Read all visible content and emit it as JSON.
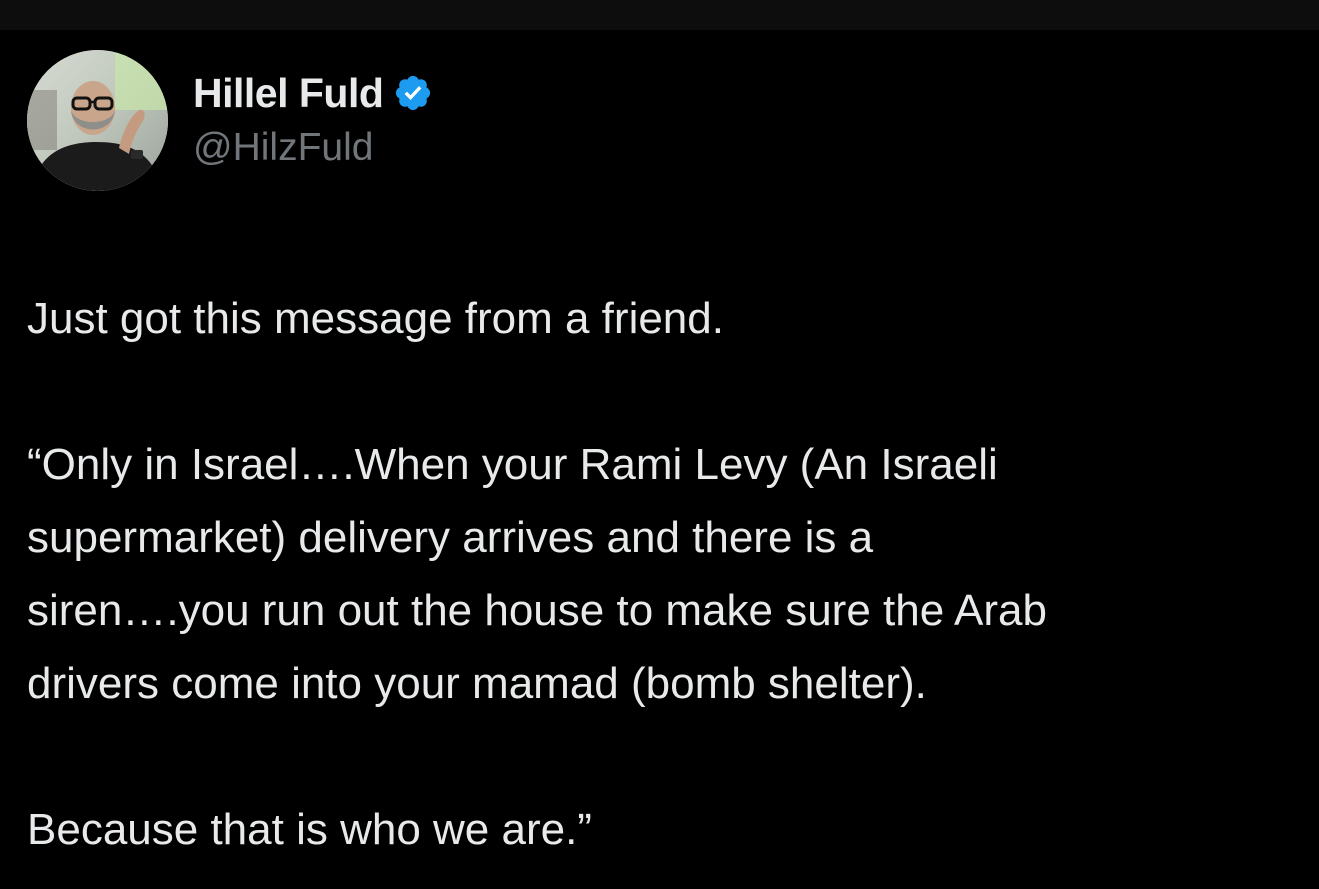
{
  "tweet": {
    "author": {
      "display_name": "Hillel Fuld",
      "handle": "@HilzFuld",
      "verified": true,
      "avatar_icon": "user-avatar-photo",
      "badge_icon": "verified-badge-icon",
      "badge_color": "#1d9bf0"
    },
    "paragraphs": [
      "Just got this message from a friend.",
      "“Only in Israel….When your Rami Levy (An Israeli",
      "supermarket) delivery arrives and there is a",
      "siren….you run out the house to make sure the Arab",
      "drivers come into your mamad (bomb shelter).",
      "Because that is who we are.”"
    ]
  },
  "colors": {
    "background": "#000000",
    "text_primary": "#e7e9ea",
    "text_secondary": "#71767b"
  }
}
